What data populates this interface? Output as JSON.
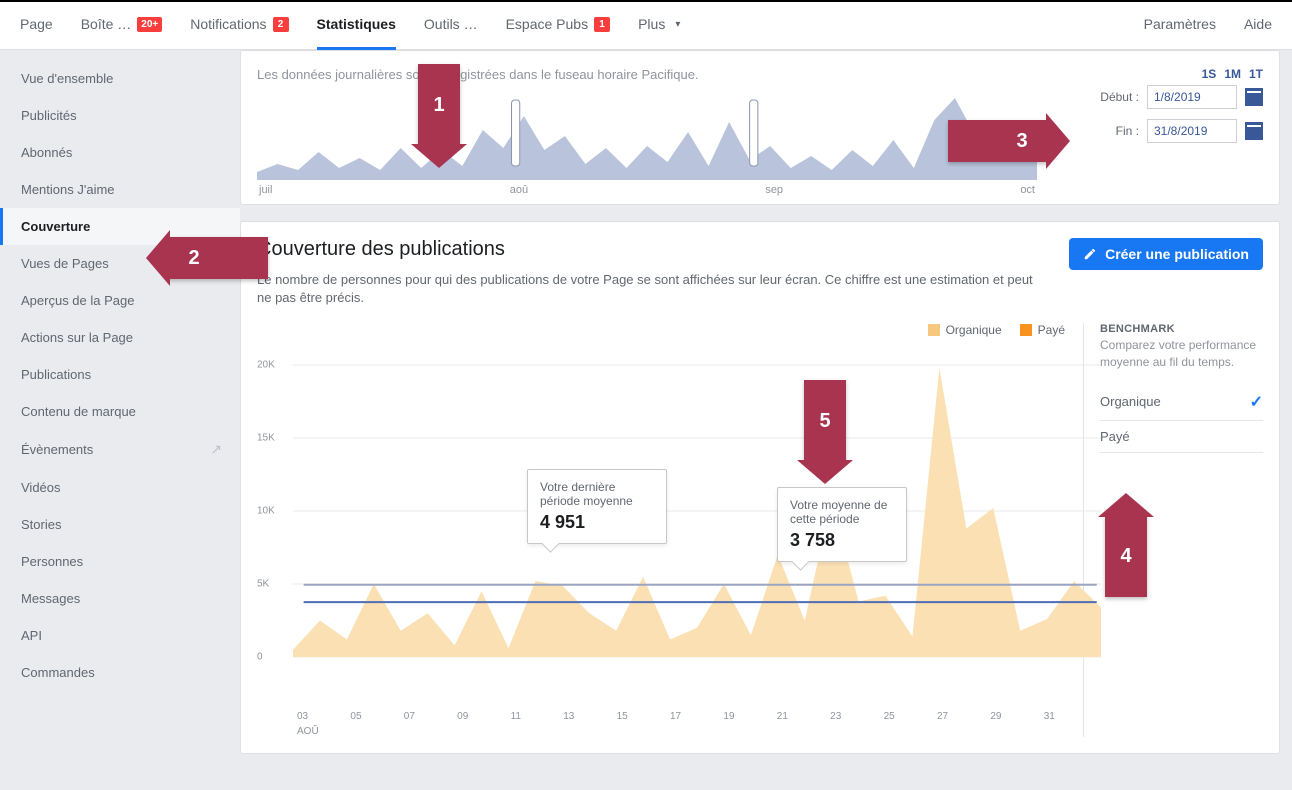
{
  "nav": {
    "items": [
      {
        "label": "Page"
      },
      {
        "label": "Boîte …",
        "badge": "20+"
      },
      {
        "label": "Notifications",
        "badge": "2"
      },
      {
        "label": "Statistiques",
        "active": true
      },
      {
        "label": "Outils …"
      },
      {
        "label": "Espace Pubs",
        "badge": "1"
      },
      {
        "label": "Plus",
        "dropdown": true
      }
    ],
    "right": [
      {
        "label": "Paramètres"
      },
      {
        "label": "Aide"
      }
    ]
  },
  "sidebar": {
    "items": [
      "Vue d'ensemble",
      "Publicités",
      "Abonnés",
      "Mentions J'aime",
      "Couverture",
      "Vues de Pages",
      "Aperçus de la Page",
      "Actions sur la Page",
      "Publications",
      "Contenu de marque",
      "Évènements",
      "Vidéos",
      "Stories",
      "Personnes",
      "Messages",
      "API",
      "Commandes"
    ],
    "active_index": 4,
    "ext_index": 10
  },
  "datecard": {
    "caption": "Les données journalières sont enregistrées dans le fuseau horaire Pacifique.",
    "tf": [
      "1S",
      "1M",
      "1T"
    ],
    "start_label": "Début :",
    "end_label": "Fin :",
    "start": "1/8/2019",
    "end": "31/8/2019",
    "months": [
      "juil",
      "aoû",
      "sep",
      "oct"
    ]
  },
  "coverage": {
    "title": "Couverture des publications",
    "desc": "Le nombre de personnes pour qui des publications de votre Page se sont affichées sur leur écran. Ce chiffre est une estimation et peut ne pas être précis.",
    "create_btn": "Créer une publication",
    "legend_org": "Organique",
    "legend_paid": "Payé"
  },
  "benchmark": {
    "title": "BENCHMARK",
    "desc": "Comparez votre performance moyenne au fil du temps.",
    "row_org": "Organique",
    "row_paid": "Payé"
  },
  "tooltipA": {
    "text": "Votre dernière période moyenne",
    "value": "4 951"
  },
  "tooltipB": {
    "text": "Votre moyenne de cette période",
    "value": "3 758"
  },
  "annotations": {
    "a1": "1",
    "a2": "2",
    "a3": "3",
    "a4": "4",
    "a5": "5"
  },
  "chart_data": {
    "type": "area",
    "title": "Couverture des publications",
    "xlabel": "AOÛ",
    "ylabel": "",
    "ylim": [
      0,
      20000
    ],
    "yticks": [
      0,
      5000,
      10000,
      15000,
      20000
    ],
    "ytick_labels": [
      "0",
      "5K",
      "10K",
      "15K",
      "20K"
    ],
    "x": [
      1,
      2,
      3,
      4,
      5,
      6,
      7,
      8,
      9,
      10,
      11,
      12,
      13,
      14,
      15,
      16,
      17,
      18,
      19,
      20,
      21,
      22,
      23,
      24,
      25,
      26,
      27,
      28,
      29,
      30,
      31
    ],
    "xtick_labels": [
      "03",
      "05",
      "07",
      "09",
      "11",
      "13",
      "15",
      "17",
      "19",
      "21",
      "23",
      "25",
      "27",
      "29",
      "31"
    ],
    "series": [
      {
        "name": "Organique",
        "color": "#f7c77f",
        "values": [
          500,
          2500,
          1200,
          5000,
          1800,
          3000,
          800,
          4500,
          600,
          5200,
          4900,
          3000,
          1800,
          5500,
          1200,
          2000,
          5000,
          1500,
          7000,
          2500,
          10800,
          3800,
          4200,
          1400,
          19800,
          8800,
          10200,
          1800,
          2600,
          5200,
          3400
        ]
      },
      {
        "name": "Payé",
        "color": "#f7931e",
        "values": [
          0,
          0,
          0,
          0,
          0,
          0,
          0,
          0,
          0,
          0,
          0,
          0,
          0,
          0,
          0,
          0,
          0,
          0,
          0,
          0,
          0,
          0,
          0,
          0,
          0,
          0,
          0,
          0,
          0,
          0,
          0
        ]
      }
    ],
    "reference_lines": [
      {
        "label": "Votre dernière période moyenne",
        "value": 4951,
        "color": "#9aa6c1"
      },
      {
        "label": "Votre moyenne de cette période",
        "value": 3758,
        "color": "#4f6db3"
      }
    ],
    "mini_timeline": {
      "months": [
        "juil",
        "aoû",
        "sep",
        "oct"
      ],
      "selection": [
        "aoû start",
        "aoû end"
      ]
    }
  }
}
